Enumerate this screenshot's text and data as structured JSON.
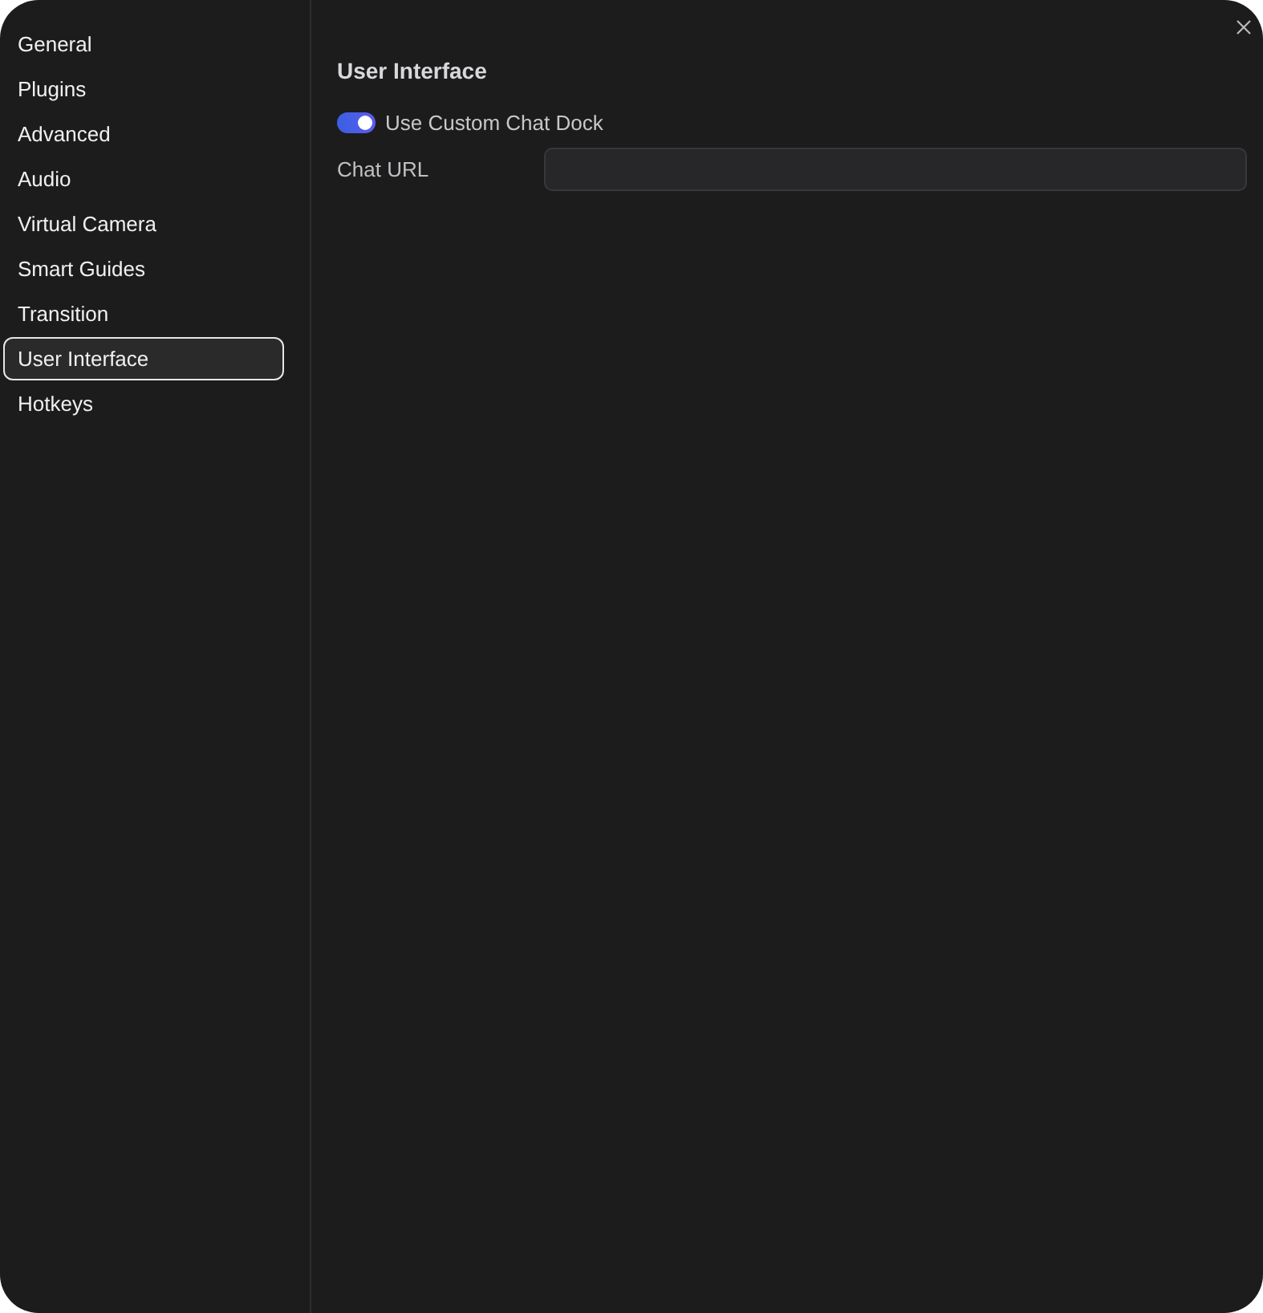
{
  "sidebar": {
    "items": [
      {
        "label": "General",
        "selected": false
      },
      {
        "label": "Plugins",
        "selected": false
      },
      {
        "label": "Advanced",
        "selected": false
      },
      {
        "label": "Audio",
        "selected": false
      },
      {
        "label": "Virtual Camera",
        "selected": false
      },
      {
        "label": "Smart Guides",
        "selected": false
      },
      {
        "label": "Transition",
        "selected": false
      },
      {
        "label": "User Interface",
        "selected": true
      },
      {
        "label": "Hotkeys",
        "selected": false
      }
    ]
  },
  "panel": {
    "title": "User Interface",
    "toggle": {
      "label": "Use Custom Chat Dock",
      "on": true
    },
    "field": {
      "label": "Chat URL"
    }
  }
}
